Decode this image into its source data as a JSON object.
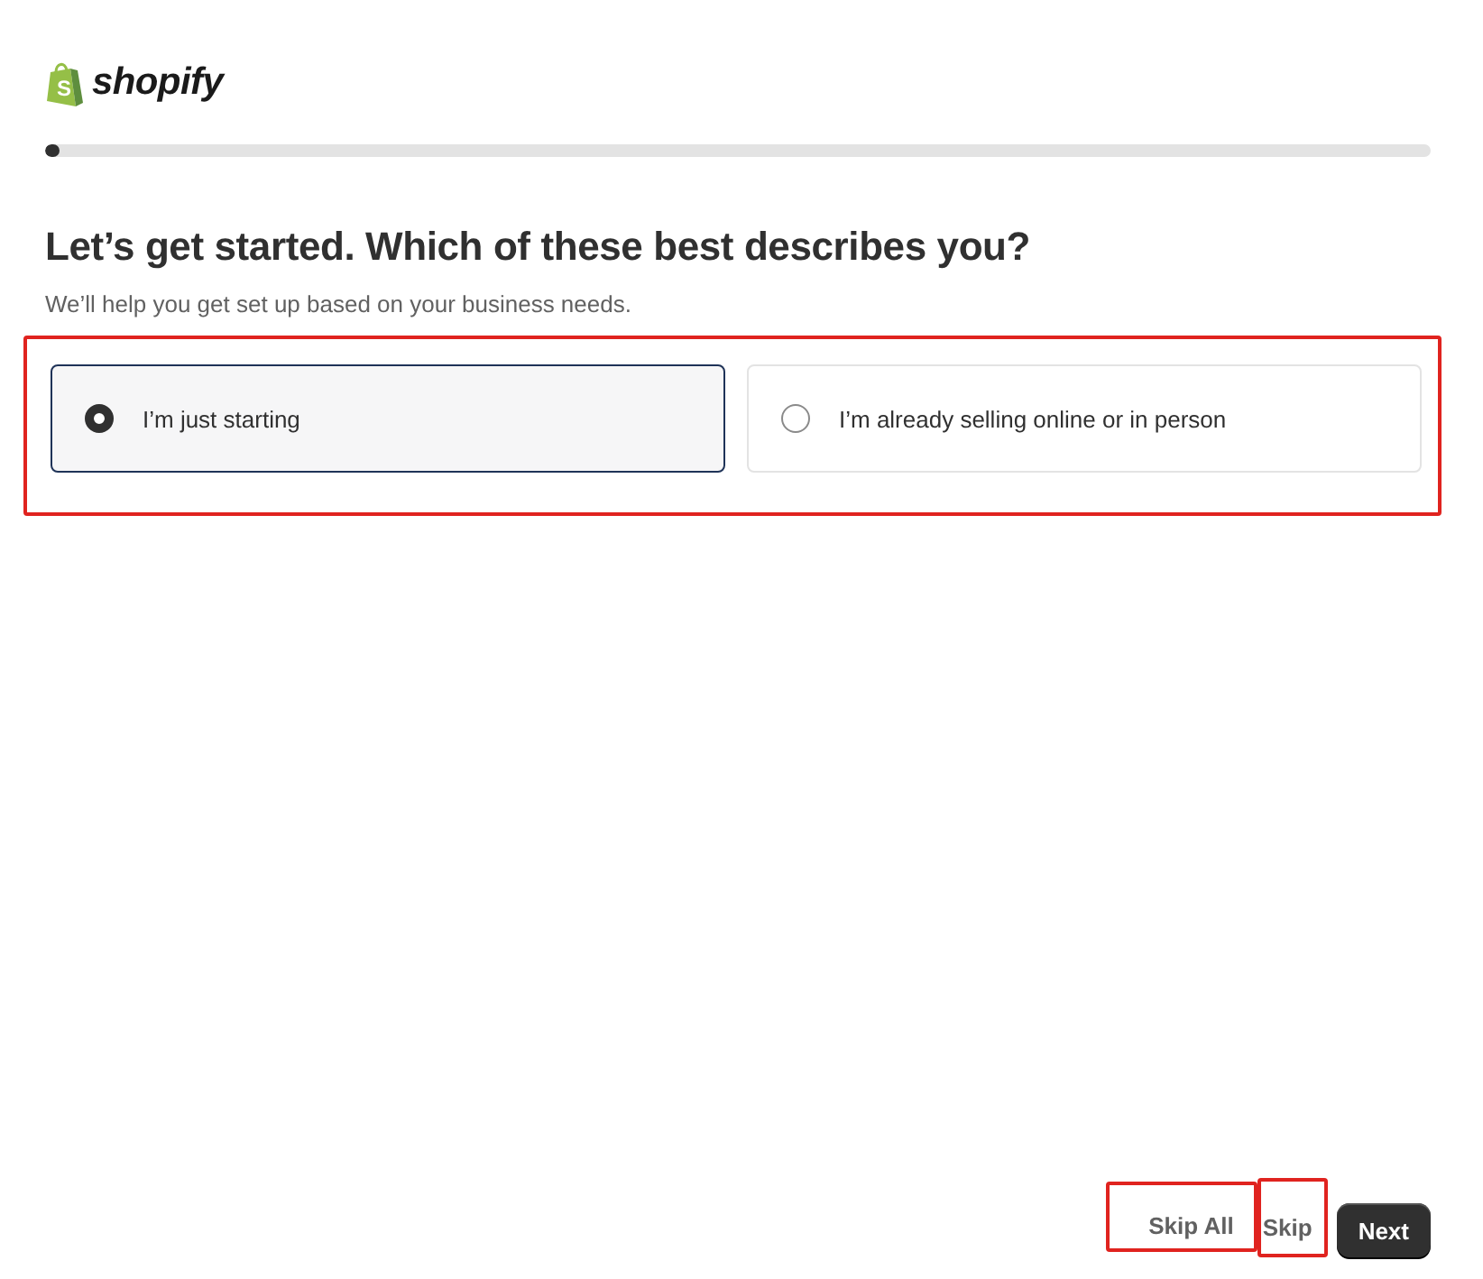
{
  "logo": {
    "badge_letter": "S",
    "wordmark": "shopify"
  },
  "progress": {
    "level": 0.01
  },
  "heading": "Let’s get started. Which of these best describes you?",
  "subheading": "We’ll help you get set up based on your business needs.",
  "options": {
    "highlighted": true,
    "items": [
      {
        "label": "I’m just starting",
        "selected": true
      },
      {
        "label": "I’m already selling online or in person",
        "selected": false
      }
    ]
  },
  "actions": [
    {
      "kind": "link",
      "label": "Skip All",
      "highlighted": true
    },
    {
      "kind": "link",
      "label": "Skip",
      "highlighted": true
    },
    {
      "kind": "primary",
      "label": "Next",
      "highlighted": false
    }
  ]
}
